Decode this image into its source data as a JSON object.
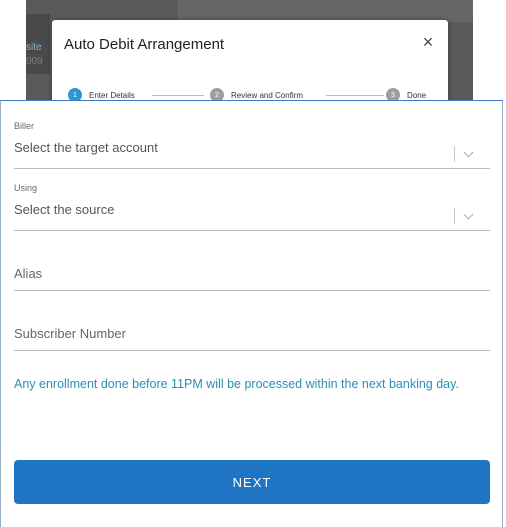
{
  "background": {
    "text_a": "site",
    "text_b": "009"
  },
  "modal": {
    "title": "Auto Debit Arrangement",
    "close_symbol": "×",
    "steps": [
      {
        "number": "1",
        "label": "Enter Details",
        "active": true
      },
      {
        "number": "2",
        "label": "Review and Confirm",
        "active": false
      },
      {
        "number": "3",
        "label": "Done",
        "active": false
      }
    ]
  },
  "form": {
    "biller": {
      "label": "Biller",
      "value": "Select the target account"
    },
    "using": {
      "label": "Using",
      "value": "Select the source"
    },
    "alias": {
      "placeholder": "Alias"
    },
    "subscriber": {
      "placeholder": "Subscriber Number"
    },
    "notice": "Any enrollment done before 11PM will be processed within the next banking day.",
    "next_label": "NEXT"
  },
  "colors": {
    "accent": "#2e95d8",
    "button": "#1f74c4",
    "notice": "#2a8fb5"
  }
}
